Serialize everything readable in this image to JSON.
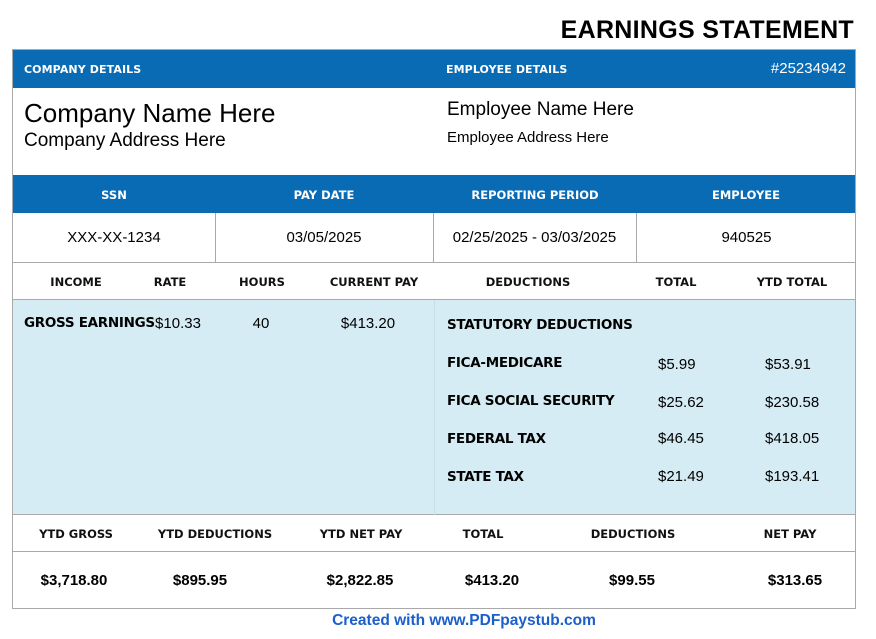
{
  "title": "EARNINGS STATEMENT",
  "header": {
    "company_details_label": "COMPANY DETAILS",
    "employee_details_label": "EMPLOYEE DETAILS",
    "statement_number": "#25234942"
  },
  "company": {
    "name": "Company Name Here",
    "address": "Company Address Here"
  },
  "employee": {
    "name": "Employee Name Here",
    "address": "Employee Address Here"
  },
  "info_headers": [
    "SSN",
    "PAY DATE",
    "REPORTING PERIOD",
    "EMPLOYEE"
  ],
  "info_values": [
    "XXX-XX-1234",
    "03/05/2025",
    "02/25/2025 - 03/03/2025",
    "940525"
  ],
  "column_headers": [
    "INCOME",
    "RATE",
    "HOURS",
    "CURRENT PAY",
    "DEDUCTIONS",
    "TOTAL",
    "YTD TOTAL"
  ],
  "earnings": {
    "label": "GROSS EARNINGS",
    "rate": "$10.33",
    "hours": "40",
    "current_pay": "$413.20"
  },
  "deductions": {
    "section_label": "STATUTORY DEDUCTIONS",
    "items": [
      {
        "label": "FICA-MEDICARE",
        "total": "$5.99",
        "ytd": "$53.91"
      },
      {
        "label": "FICA SOCIAL SECURITY",
        "total": "$25.62",
        "ytd": "$230.58"
      },
      {
        "label": "FEDERAL TAX",
        "total": "$46.45",
        "ytd": "$418.05"
      },
      {
        "label": "STATE TAX",
        "total": "$21.49",
        "ytd": "$193.41"
      }
    ]
  },
  "summary_headers": [
    "YTD GROSS",
    "YTD DEDUCTIONS",
    "YTD NET PAY",
    "TOTAL",
    "DEDUCTIONS",
    "NET PAY"
  ],
  "summary_values": [
    "$3,718.80",
    "$895.95",
    "$2,822.85",
    "$413.20",
    "$99.55",
    "$313.65"
  ],
  "footer": "Created with www.PDFpaystub.com",
  "colors": {
    "header_blue": "#0a6bb5",
    "body_light_blue": "#d6ecf5",
    "footer_link": "#1a5fcc"
  }
}
